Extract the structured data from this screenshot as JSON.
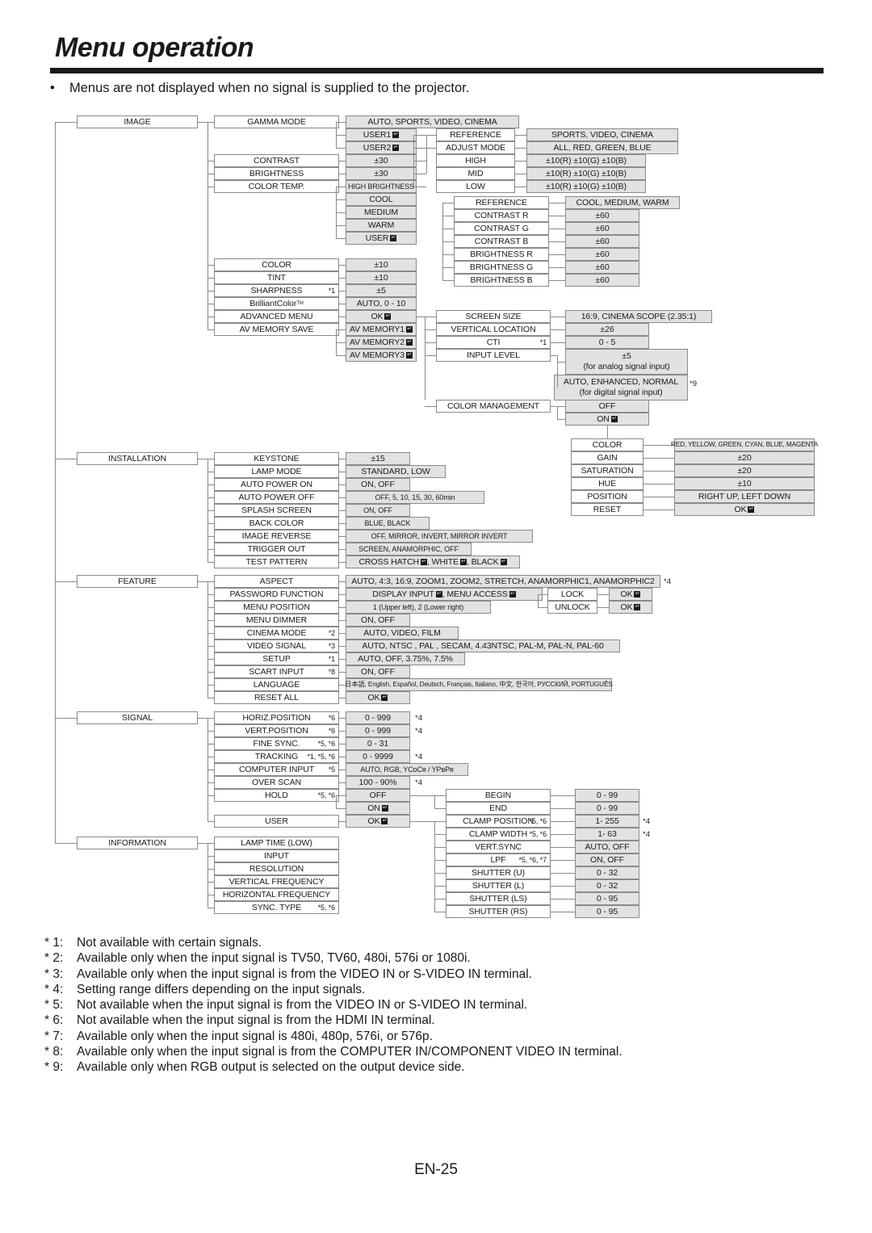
{
  "header": {
    "title": "Menu operation",
    "bullet": "Menus are not displayed when no signal is supplied to the projector."
  },
  "page": {
    "number": "EN-25"
  },
  "icons": {
    "enter": "enter-key-icon"
  },
  "menu_tree": {
    "categories": [
      "IMAGE",
      "INSTALLATION",
      "FEATURE",
      "SIGNAL",
      "INFORMATION"
    ],
    "image": {
      "items": [
        "GAMMA MODE",
        "CONTRAST",
        "BRIGHTNESS",
        "COLOR TEMP.",
        "COLOR",
        "TINT",
        "SHARPNESS",
        "BrilliantColor",
        "ADVANCED MENU",
        "AV MEMORY SAVE"
      ],
      "sharpness_note": "*1",
      "brilliantcolor_tm": "TM",
      "gamma_values": [
        "AUTO, SPORTS, VIDEO, CINEMA",
        "USER1",
        "USER2"
      ],
      "contrast_value": "±30",
      "brightness_value": "±30",
      "color_temp_values": [
        "HIGH BRIGHTNESS",
        "COOL",
        "MEDIUM",
        "WARM",
        "USER"
      ],
      "color_value": "±10",
      "tint_value": "±10",
      "sharpness_value": "±5",
      "brilliantcolor_value": "AUTO, 0 - 10",
      "advanced_menu_value": "OK",
      "av_memory_values": [
        "AV MEMORY1",
        "AV MEMORY2",
        "AV MEMORY3"
      ]
    },
    "gamma_user": {
      "items": [
        "REFERENCE",
        "ADJUST MODE",
        "HIGH",
        "MID",
        "LOW"
      ],
      "values": [
        "SPORTS, VIDEO, CINEMA",
        "ALL, RED, GREEN, BLUE",
        "±10(R) ±10(G) ±10(B)",
        "±10(R) ±10(G) ±10(B)",
        "±10(R) ±10(G) ±10(B)"
      ]
    },
    "color_temp_user": {
      "items": [
        "REFERENCE",
        "CONTRAST R",
        "CONTRAST G",
        "CONTRAST B",
        "BRIGHTNESS R",
        "BRIGHTNESS G",
        "BRIGHTNESS B"
      ],
      "values": [
        "COOL, MEDIUM, WARM",
        "±60",
        "±60",
        "±60",
        "±60",
        "±60",
        "±60"
      ]
    },
    "advanced_menu": {
      "items": [
        "SCREEN SIZE",
        "VERTICAL LOCATION",
        "CTI",
        "INPUT LEVEL",
        "COLOR MANAGEMENT"
      ],
      "cti_note": "*1",
      "screen_size_value": "16:9, CINEMA SCOPE (2.35:1)",
      "vertical_location_value": "±26",
      "cti_value": "0 - 5",
      "input_level_analog_1": "±5",
      "input_level_analog_2": "(for analog signal input)",
      "input_level_digital_1": "AUTO, ENHANCED, NORMAL",
      "input_level_digital_2": "(for digital signal input)",
      "input_level_note": "*9",
      "color_management_values": [
        "OFF",
        "ON"
      ]
    },
    "color_management": {
      "items": [
        "COLOR",
        "GAIN",
        "SATURATION",
        "HUE",
        "POSITION",
        "RESET"
      ],
      "values": [
        "RED, YELLOW, GREEN, CYAN, BLUE, MAGENTA",
        "±20",
        "±20",
        "±10",
        "RIGHT UP, LEFT DOWN",
        "OK"
      ]
    },
    "installation": {
      "items": [
        "KEYSTONE",
        "LAMP MODE",
        "AUTO POWER ON",
        "AUTO POWER OFF",
        "SPLASH SCREEN",
        "BACK COLOR",
        "IMAGE REVERSE",
        "TRIGGER OUT",
        "TEST PATTERN"
      ],
      "values": [
        "±15",
        "STANDARD, LOW",
        "ON, OFF",
        "OFF, 5, 10, 15, 30, 60min",
        "ON, OFF",
        "BLUE, BLACK",
        "OFF, MIRROR, INVERT, MIRROR INVERT",
        "SCREEN, ANAMORPHIC, OFF",
        "CROSS HATCH, WHITE, BLACK"
      ],
      "test_pattern_parts": [
        "CROSS HATCH",
        ", WHITE",
        ", BLACK"
      ]
    },
    "feature": {
      "items": [
        "ASPECT",
        "PASSWORD FUNCTION",
        "MENU POSITION",
        "MENU DIMMER",
        "CINEMA MODE",
        "VIDEO SIGNAL",
        "SETUP",
        "SCART INPUT",
        "LANGUAGE",
        "RESET ALL"
      ],
      "notes": {
        "cinema_mode": "*2",
        "video_signal": "*3",
        "setup": "*1",
        "scart_input": "*8"
      },
      "aspect_value": "AUTO, 4:3, 16:9, ZOOM1, ZOOM2, STRETCH, ANAMORPHIC1, ANAMORPHIC2",
      "aspect_note": "*4",
      "password_parts": [
        "DISPLAY INPUT",
        ", MENU ACCESS"
      ],
      "password_sub": [
        "LOCK",
        "UNLOCK"
      ],
      "password_sub_values": [
        "OK",
        "OK"
      ],
      "menu_position_value": "1 (Upper left), 2 (Lower right)",
      "menu_dimmer_value": "ON, OFF",
      "cinema_mode_value": "AUTO, VIDEO, FILM",
      "video_signal_value": "AUTO, NTSC , PAL , SECAM, 4.43NTSC, PAL-M, PAL-N, PAL-60",
      "setup_value": "AUTO, OFF, 3.75%, 7.5%",
      "scart_input_value": "ON, OFF",
      "language_value": "日本語, English, Español, Deutsch, Français, Italiano, 中文, 한국어, РУССКИЙ, PORTUGUÊS",
      "reset_all_value": "OK"
    },
    "signal": {
      "items": [
        "HORIZ.POSITION",
        "VERT.POSITION",
        "FINE SYNC.",
        "TRACKING",
        "COMPUTER INPUT",
        "OVER SCAN",
        "HOLD",
        "USER"
      ],
      "notes": {
        "horiz_position": "*6",
        "vert_position": "*6",
        "fine_sync": "*5, *6",
        "tracking": "*1, *5, *6",
        "computer_input": "*5",
        "hold": "*5, *6"
      },
      "values": [
        "0 - 999",
        "0 - 999",
        "0 - 31",
        "0 - 9999",
        "AUTO, RGB, YCᴅCʀ / YPʙPʀ",
        "100 - 90%"
      ],
      "computer_input_value_parts": [
        "AUTO, RGB, YC",
        "B",
        "C",
        "R",
        " / YP",
        "B",
        "P",
        "R"
      ],
      "hold_values": [
        "OFF",
        "ON"
      ],
      "user_value": "OK",
      "range_notes": {
        "horiz": "*4",
        "vert": "*4",
        "tracking": "*4",
        "overscan": "*4"
      }
    },
    "signal_user": {
      "items": [
        "BEGIN",
        "END",
        "CLAMP POSITION",
        "CLAMP WIDTH",
        "VERT.SYNC",
        "LPF",
        "SHUTTER (U)",
        "SHUTTER (L)",
        "SHUTTER (LS)",
        "SHUTTER (RS)"
      ],
      "notes": {
        "clamp_position": "*5, *6",
        "clamp_width": "*5, *6",
        "lpf": "*5, *6, *7"
      },
      "values": [
        "0 - 99",
        "0 - 99",
        "1- 255",
        "1- 63",
        "AUTO, OFF",
        "ON, OFF",
        "0 - 32",
        "0 - 32",
        "0 - 95",
        "0 - 95"
      ],
      "range_notes": {
        "clamp_position": "*4",
        "clamp_width": "*4"
      }
    },
    "information": {
      "items": [
        "LAMP TIME (LOW)",
        "INPUT",
        "RESOLUTION",
        "VERTICAL FREQUENCY",
        "HORIZONTAL FREQUENCY",
        "SYNC. TYPE"
      ],
      "notes": {
        "sync_type": "*5, *6"
      }
    }
  },
  "footnotes": [
    {
      "num": "* 1:",
      "text": "Not available with certain signals."
    },
    {
      "num": "* 2:",
      "text": "Available only when the input signal is TV50, TV60, 480i, 576i or 1080i."
    },
    {
      "num": "* 3:",
      "text": "Available only when the input signal is from the VIDEO IN or S-VIDEO IN terminal."
    },
    {
      "num": "* 4:",
      "text": "Setting range differs depending on the input signals."
    },
    {
      "num": "* 5:",
      "text": "Not available when the input signal is from the VIDEO IN or S-VIDEO IN terminal."
    },
    {
      "num": "* 6:",
      "text": "Not available when the input signal is from the HDMI IN terminal."
    },
    {
      "num": "* 7:",
      "text": "Available only when the input signal is 480i, 480p, 576i, or 576p."
    },
    {
      "num": "* 8:",
      "text": "Available only when the input signal is from the COMPUTER IN/COMPONENT VIDEO IN terminal."
    },
    {
      "num": "* 9:",
      "text": "Available only when RGB output is selected on the output device side."
    }
  ]
}
